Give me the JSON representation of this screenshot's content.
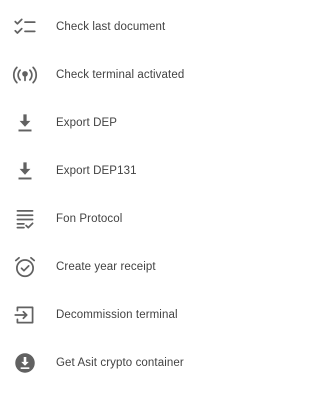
{
  "menu": {
    "icon_color": "#616161",
    "text_color": "#424242",
    "items": [
      {
        "label": "Check last document",
        "icon": "checklist-icon"
      },
      {
        "label": "Check terminal activated",
        "icon": "broadcast-signal-icon"
      },
      {
        "label": "Export DEP",
        "icon": "download-icon"
      },
      {
        "label": "Export DEP131",
        "icon": "download-icon"
      },
      {
        "label": "Fon Protocol",
        "icon": "list-check-icon"
      },
      {
        "label": "Create year receipt",
        "icon": "alarm-check-icon"
      },
      {
        "label": "Decommission terminal",
        "icon": "exit-to-app-icon"
      },
      {
        "label": "Get Asit crypto container",
        "icon": "download-circle-icon"
      }
    ]
  }
}
